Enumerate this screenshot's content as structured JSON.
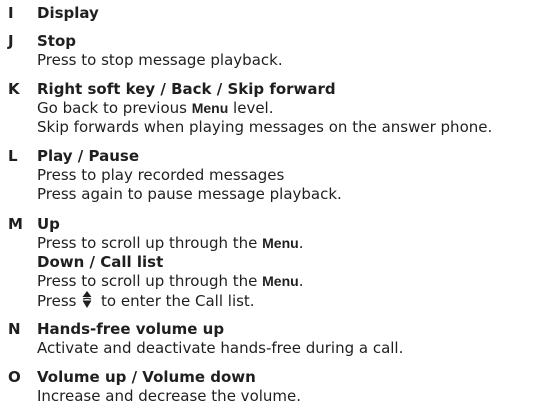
{
  "entries": [
    {
      "letter": "I",
      "title": "Display"
    },
    {
      "letter": "J",
      "title": "Stop",
      "desc": "Press to stop message playback."
    },
    {
      "letter": "K",
      "title": "Right soft key / Back / Skip forward",
      "line1_pre": "Go back to previous ",
      "line1_menu": "Menu",
      "line1_post": " level.",
      "line2": "Skip forwards when playing messages on the answer phone."
    },
    {
      "letter": "L",
      "title": "Play / Pause",
      "line1": "Press to play recorded messages",
      "line2": "Press again to pause message playback."
    },
    {
      "letter": "M",
      "title": "Up",
      "line1_pre": "Press to scroll up through the ",
      "line1_menu": "Menu",
      "line1_post": ".",
      "subtitle": "Down / Call list",
      "line2_pre": "Press to scroll up through the ",
      "line2_menu": "Menu",
      "line2_post": ".",
      "line3_pre": "Press ",
      "line3_post": " to enter the Call list."
    },
    {
      "letter": "N",
      "title": "Hands-free volume up",
      "desc": "Activate and deactivate hands-free during a call."
    },
    {
      "letter": "O",
      "title": "Volume up / Volume down",
      "desc": "Increase and decrease the volume."
    }
  ],
  "icons": {
    "call_list": "nav-down-key-icon"
  }
}
